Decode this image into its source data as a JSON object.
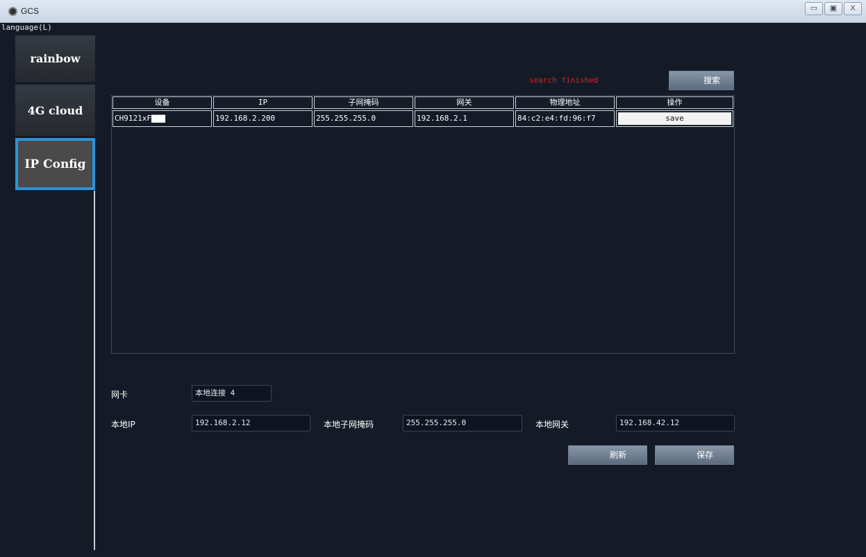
{
  "window": {
    "title": "GCS",
    "controls": {
      "minimize": "▭",
      "maximize": "▣",
      "close": "X"
    }
  },
  "menu": {
    "language": "language(L)"
  },
  "sidebar": {
    "items": [
      {
        "label": "rainbow"
      },
      {
        "label": "4G cloud"
      },
      {
        "label": "IP Config",
        "active": true
      }
    ]
  },
  "search": {
    "status": "search finished",
    "button_label": "搜索",
    "status_color": "#e02020"
  },
  "table": {
    "columns": [
      "设备",
      "IP",
      "子网掩码",
      "网关",
      "物理地址",
      "操作"
    ],
    "rows": [
      {
        "device": "CH9121xF▇▇▇",
        "ip": "192.168.2.200",
        "mask": "255.255.255.0",
        "gateway": "192.168.2.1",
        "mac": "84:c2:e4:fd:96:f7",
        "action": "save"
      }
    ]
  },
  "form": {
    "nic_label": "网卡",
    "nic_value": "本地连接 4",
    "local_ip_label": "本地IP",
    "local_ip_value": "192.168.2.12",
    "local_mask_label": "本地子网掩码",
    "local_mask_value": "255.255.255.0",
    "local_gateway_label": "本地网关",
    "local_gateway_value": "192.168.42.12",
    "refresh_label": "刷新",
    "save_label": "保存"
  },
  "colors": {
    "background": "#141b27",
    "active_border": "#2b93d8",
    "button": "#6f7e91"
  }
}
